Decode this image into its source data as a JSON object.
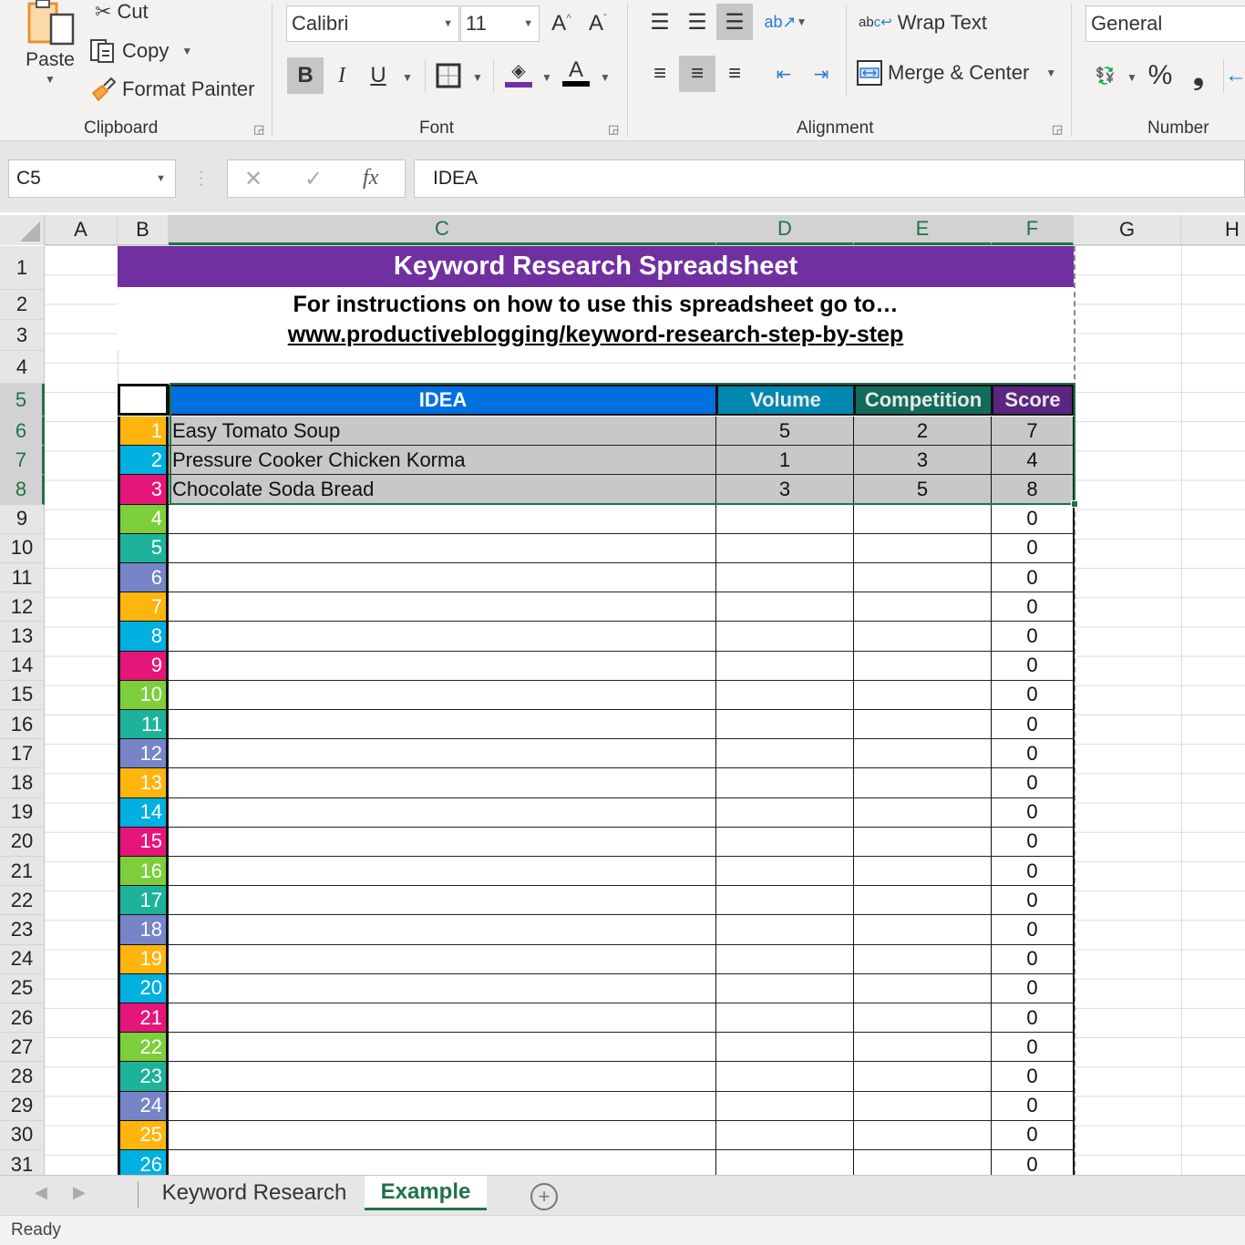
{
  "ribbon": {
    "clipboard": {
      "label": "Clipboard",
      "paste": "Paste",
      "cut": "Cut",
      "copy": "Copy",
      "format_painter": "Format Painter"
    },
    "font": {
      "label": "Font",
      "font_name": "Calibri",
      "font_size": "11",
      "bold": "B",
      "italic": "I",
      "underline": "U",
      "fill_color": "#7030a0",
      "font_color": "#000000"
    },
    "alignment": {
      "label": "Alignment",
      "wrap_text": "Wrap Text",
      "merge_center": "Merge & Center"
    },
    "number": {
      "label": "Number",
      "format": "General",
      "percent": "%",
      "comma": "❟"
    }
  },
  "formula_bar": {
    "name_box": "C5",
    "cancel": "✕",
    "enter": "✓",
    "fx": "fx",
    "content": "IDEA"
  },
  "columns": [
    "A",
    "B",
    "C",
    "D",
    "E",
    "F",
    "G",
    "H"
  ],
  "selected_column_headers": [
    "C",
    "D",
    "E",
    "F"
  ],
  "rows": [
    "1",
    "2",
    "3",
    "4",
    "5",
    "6",
    "7",
    "8",
    "9",
    "10",
    "11",
    "12",
    "13",
    "14",
    "15",
    "16",
    "17",
    "18",
    "19",
    "20",
    "21",
    "22",
    "23",
    "24",
    "25",
    "26",
    "27",
    "28",
    "29",
    "30",
    "31"
  ],
  "selected_row_headers": [
    "5",
    "6",
    "7",
    "8"
  ],
  "sheet": {
    "title": "Keyword Research Spreadsheet",
    "instructions": "For instructions on how to use this spreadsheet go to…",
    "link": "www.productiveblogging/keyword-research-step-by-step",
    "header": {
      "idea": "IDEA",
      "volume": "Volume",
      "competition": "Competition",
      "score": "Score"
    },
    "header_colors": {
      "title": "#7030a0",
      "idea": "#0070e0",
      "volume": "#0088b0",
      "competition": "#126b5c",
      "score": "#5b2580"
    },
    "number_colors": [
      "#ffb50d",
      "#00b0e0",
      "#e6157a",
      "#7ccf3b",
      "#1db39a",
      "#7585c8"
    ],
    "entries": [
      {
        "n": "1",
        "idea": "Easy Tomato Soup",
        "volume": "5",
        "competition": "2",
        "score": "7"
      },
      {
        "n": "2",
        "idea": "Pressure Cooker Chicken Korma",
        "volume": "1",
        "competition": "3",
        "score": "4"
      },
      {
        "n": "3",
        "idea": "Chocolate Soda Bread",
        "volume": "3",
        "competition": "5",
        "score": "8"
      },
      {
        "n": "4",
        "idea": "",
        "volume": "",
        "competition": "",
        "score": "0"
      },
      {
        "n": "5",
        "idea": "",
        "volume": "",
        "competition": "",
        "score": "0"
      },
      {
        "n": "6",
        "idea": "",
        "volume": "",
        "competition": "",
        "score": "0"
      },
      {
        "n": "7",
        "idea": "",
        "volume": "",
        "competition": "",
        "score": "0"
      },
      {
        "n": "8",
        "idea": "",
        "volume": "",
        "competition": "",
        "score": "0"
      },
      {
        "n": "9",
        "idea": "",
        "volume": "",
        "competition": "",
        "score": "0"
      },
      {
        "n": "10",
        "idea": "",
        "volume": "",
        "competition": "",
        "score": "0"
      },
      {
        "n": "11",
        "idea": "",
        "volume": "",
        "competition": "",
        "score": "0"
      },
      {
        "n": "12",
        "idea": "",
        "volume": "",
        "competition": "",
        "score": "0"
      },
      {
        "n": "13",
        "idea": "",
        "volume": "",
        "competition": "",
        "score": "0"
      },
      {
        "n": "14",
        "idea": "",
        "volume": "",
        "competition": "",
        "score": "0"
      },
      {
        "n": "15",
        "idea": "",
        "volume": "",
        "competition": "",
        "score": "0"
      },
      {
        "n": "16",
        "idea": "",
        "volume": "",
        "competition": "",
        "score": "0"
      },
      {
        "n": "17",
        "idea": "",
        "volume": "",
        "competition": "",
        "score": "0"
      },
      {
        "n": "18",
        "idea": "",
        "volume": "",
        "competition": "",
        "score": "0"
      },
      {
        "n": "19",
        "idea": "",
        "volume": "",
        "competition": "",
        "score": "0"
      },
      {
        "n": "20",
        "idea": "",
        "volume": "",
        "competition": "",
        "score": "0"
      },
      {
        "n": "21",
        "idea": "",
        "volume": "",
        "competition": "",
        "score": "0"
      },
      {
        "n": "22",
        "idea": "",
        "volume": "",
        "competition": "",
        "score": "0"
      },
      {
        "n": "23",
        "idea": "",
        "volume": "",
        "competition": "",
        "score": "0"
      },
      {
        "n": "24",
        "idea": "",
        "volume": "",
        "competition": "",
        "score": "0"
      },
      {
        "n": "25",
        "idea": "",
        "volume": "",
        "competition": "",
        "score": "0"
      },
      {
        "n": "26",
        "idea": "",
        "volume": "",
        "competition": "",
        "score": "0"
      }
    ]
  },
  "tabs": [
    {
      "label": "Keyword Research",
      "active": false
    },
    {
      "label": "Example",
      "active": true
    }
  ],
  "add_sheet": "+",
  "status": "Ready"
}
